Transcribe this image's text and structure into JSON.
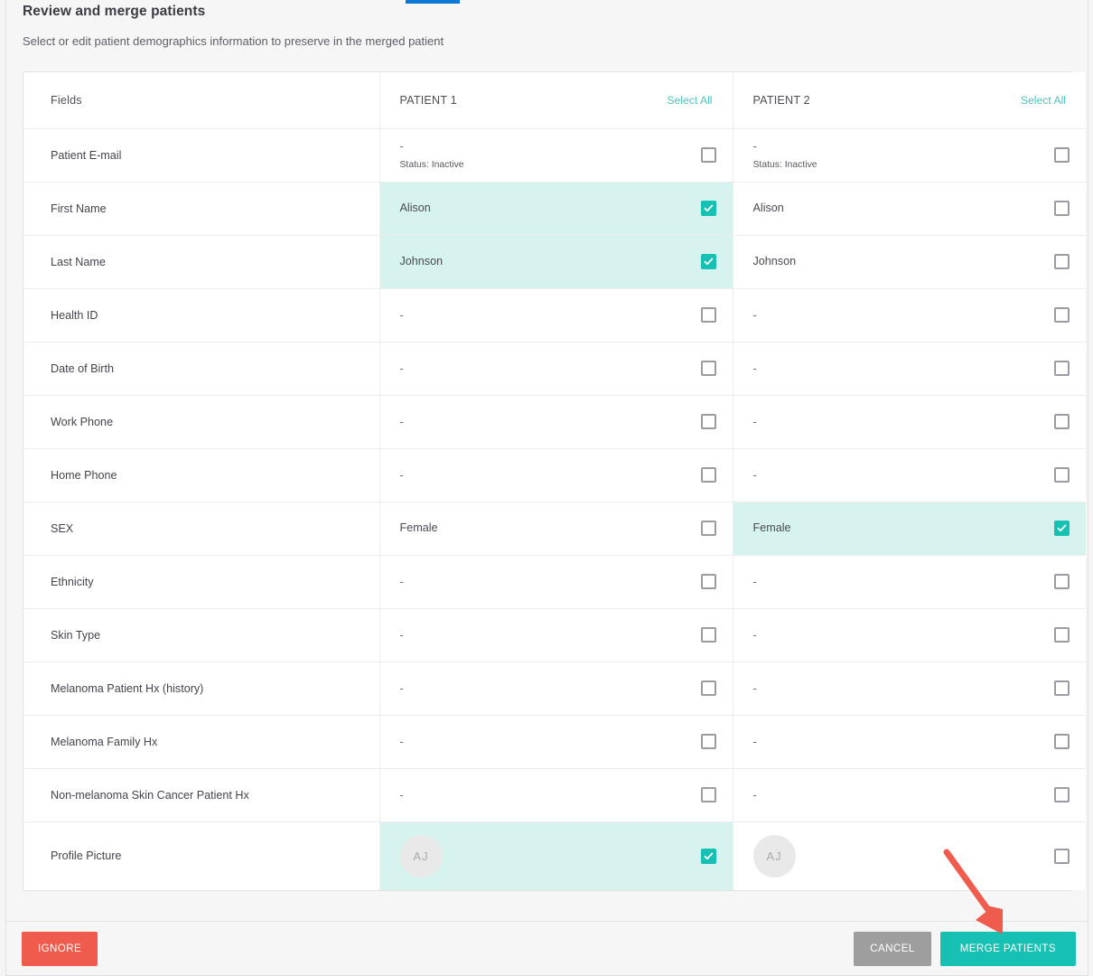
{
  "dialog": {
    "title": "Review and merge patients",
    "subtitle": "Select or edit patient demographics information to preserve in the merged patient"
  },
  "table": {
    "headers": {
      "fields": "Fields",
      "patient1": "PATIENT 1",
      "patient2": "PATIENT 2",
      "select_all_1": "Select All",
      "select_all_2": "Select All"
    },
    "rows": [
      {
        "field": "Patient E-mail",
        "p1": {
          "value": "-",
          "status": "Status: Inactive",
          "checked": false,
          "selected": false
        },
        "p2": {
          "value": "-",
          "status": "Status: Inactive",
          "checked": false,
          "selected": false
        }
      },
      {
        "field": "First Name",
        "p1": {
          "value": "Alison",
          "checked": true,
          "selected": true
        },
        "p2": {
          "value": "Alison",
          "checked": false,
          "selected": false
        }
      },
      {
        "field": "Last Name",
        "p1": {
          "value": "Johnson",
          "checked": true,
          "selected": true
        },
        "p2": {
          "value": "Johnson",
          "checked": false,
          "selected": false
        }
      },
      {
        "field": "Health ID",
        "p1": {
          "value": "-",
          "checked": false,
          "selected": false
        },
        "p2": {
          "value": "-",
          "checked": false,
          "selected": false
        }
      },
      {
        "field": "Date of Birth",
        "p1": {
          "value": "-",
          "checked": false,
          "selected": false
        },
        "p2": {
          "value": "-",
          "checked": false,
          "selected": false
        }
      },
      {
        "field": "Work Phone",
        "p1": {
          "value": "-",
          "checked": false,
          "selected": false
        },
        "p2": {
          "value": "-",
          "checked": false,
          "selected": false
        }
      },
      {
        "field": "Home Phone",
        "p1": {
          "value": "-",
          "checked": false,
          "selected": false
        },
        "p2": {
          "value": "-",
          "checked": false,
          "selected": false
        }
      },
      {
        "field": "SEX",
        "p1": {
          "value": "Female",
          "checked": false,
          "selected": false
        },
        "p2": {
          "value": "Female",
          "checked": true,
          "selected": true
        }
      },
      {
        "field": "Ethnicity",
        "p1": {
          "value": "-",
          "checked": false,
          "selected": false
        },
        "p2": {
          "value": "-",
          "checked": false,
          "selected": false
        }
      },
      {
        "field": "Skin Type",
        "p1": {
          "value": "-",
          "checked": false,
          "selected": false
        },
        "p2": {
          "value": "-",
          "checked": false,
          "selected": false
        }
      },
      {
        "field": "Melanoma Patient Hx (history)",
        "p1": {
          "value": "-",
          "checked": false,
          "selected": false
        },
        "p2": {
          "value": "-",
          "checked": false,
          "selected": false
        }
      },
      {
        "field": "Melanoma Family Hx",
        "p1": {
          "value": "-",
          "checked": false,
          "selected": false
        },
        "p2": {
          "value": "-",
          "checked": false,
          "selected": false
        }
      },
      {
        "field": "Non-melanoma Skin Cancer Patient Hx",
        "p1": {
          "value": "-",
          "checked": false,
          "selected": false
        },
        "p2": {
          "value": "-",
          "checked": false,
          "selected": false
        }
      },
      {
        "field": "Profile Picture",
        "p1": {
          "avatar": "AJ",
          "checked": true,
          "selected": true
        },
        "p2": {
          "avatar": "AJ",
          "checked": false,
          "selected": false
        }
      }
    ]
  },
  "footer": {
    "ignore": "IGNORE",
    "cancel": "CANCEL",
    "merge": "MERGE PATIENTS"
  },
  "colors": {
    "accent_teal": "#16c0b3",
    "selected_row": "#d6f3ef",
    "danger_red": "#ef5b4c",
    "cancel_gray": "#9e9e9e",
    "link_teal": "#4ec3bb",
    "tab_blue": "#0c78d4",
    "annotation_red": "#ef5b4c"
  }
}
